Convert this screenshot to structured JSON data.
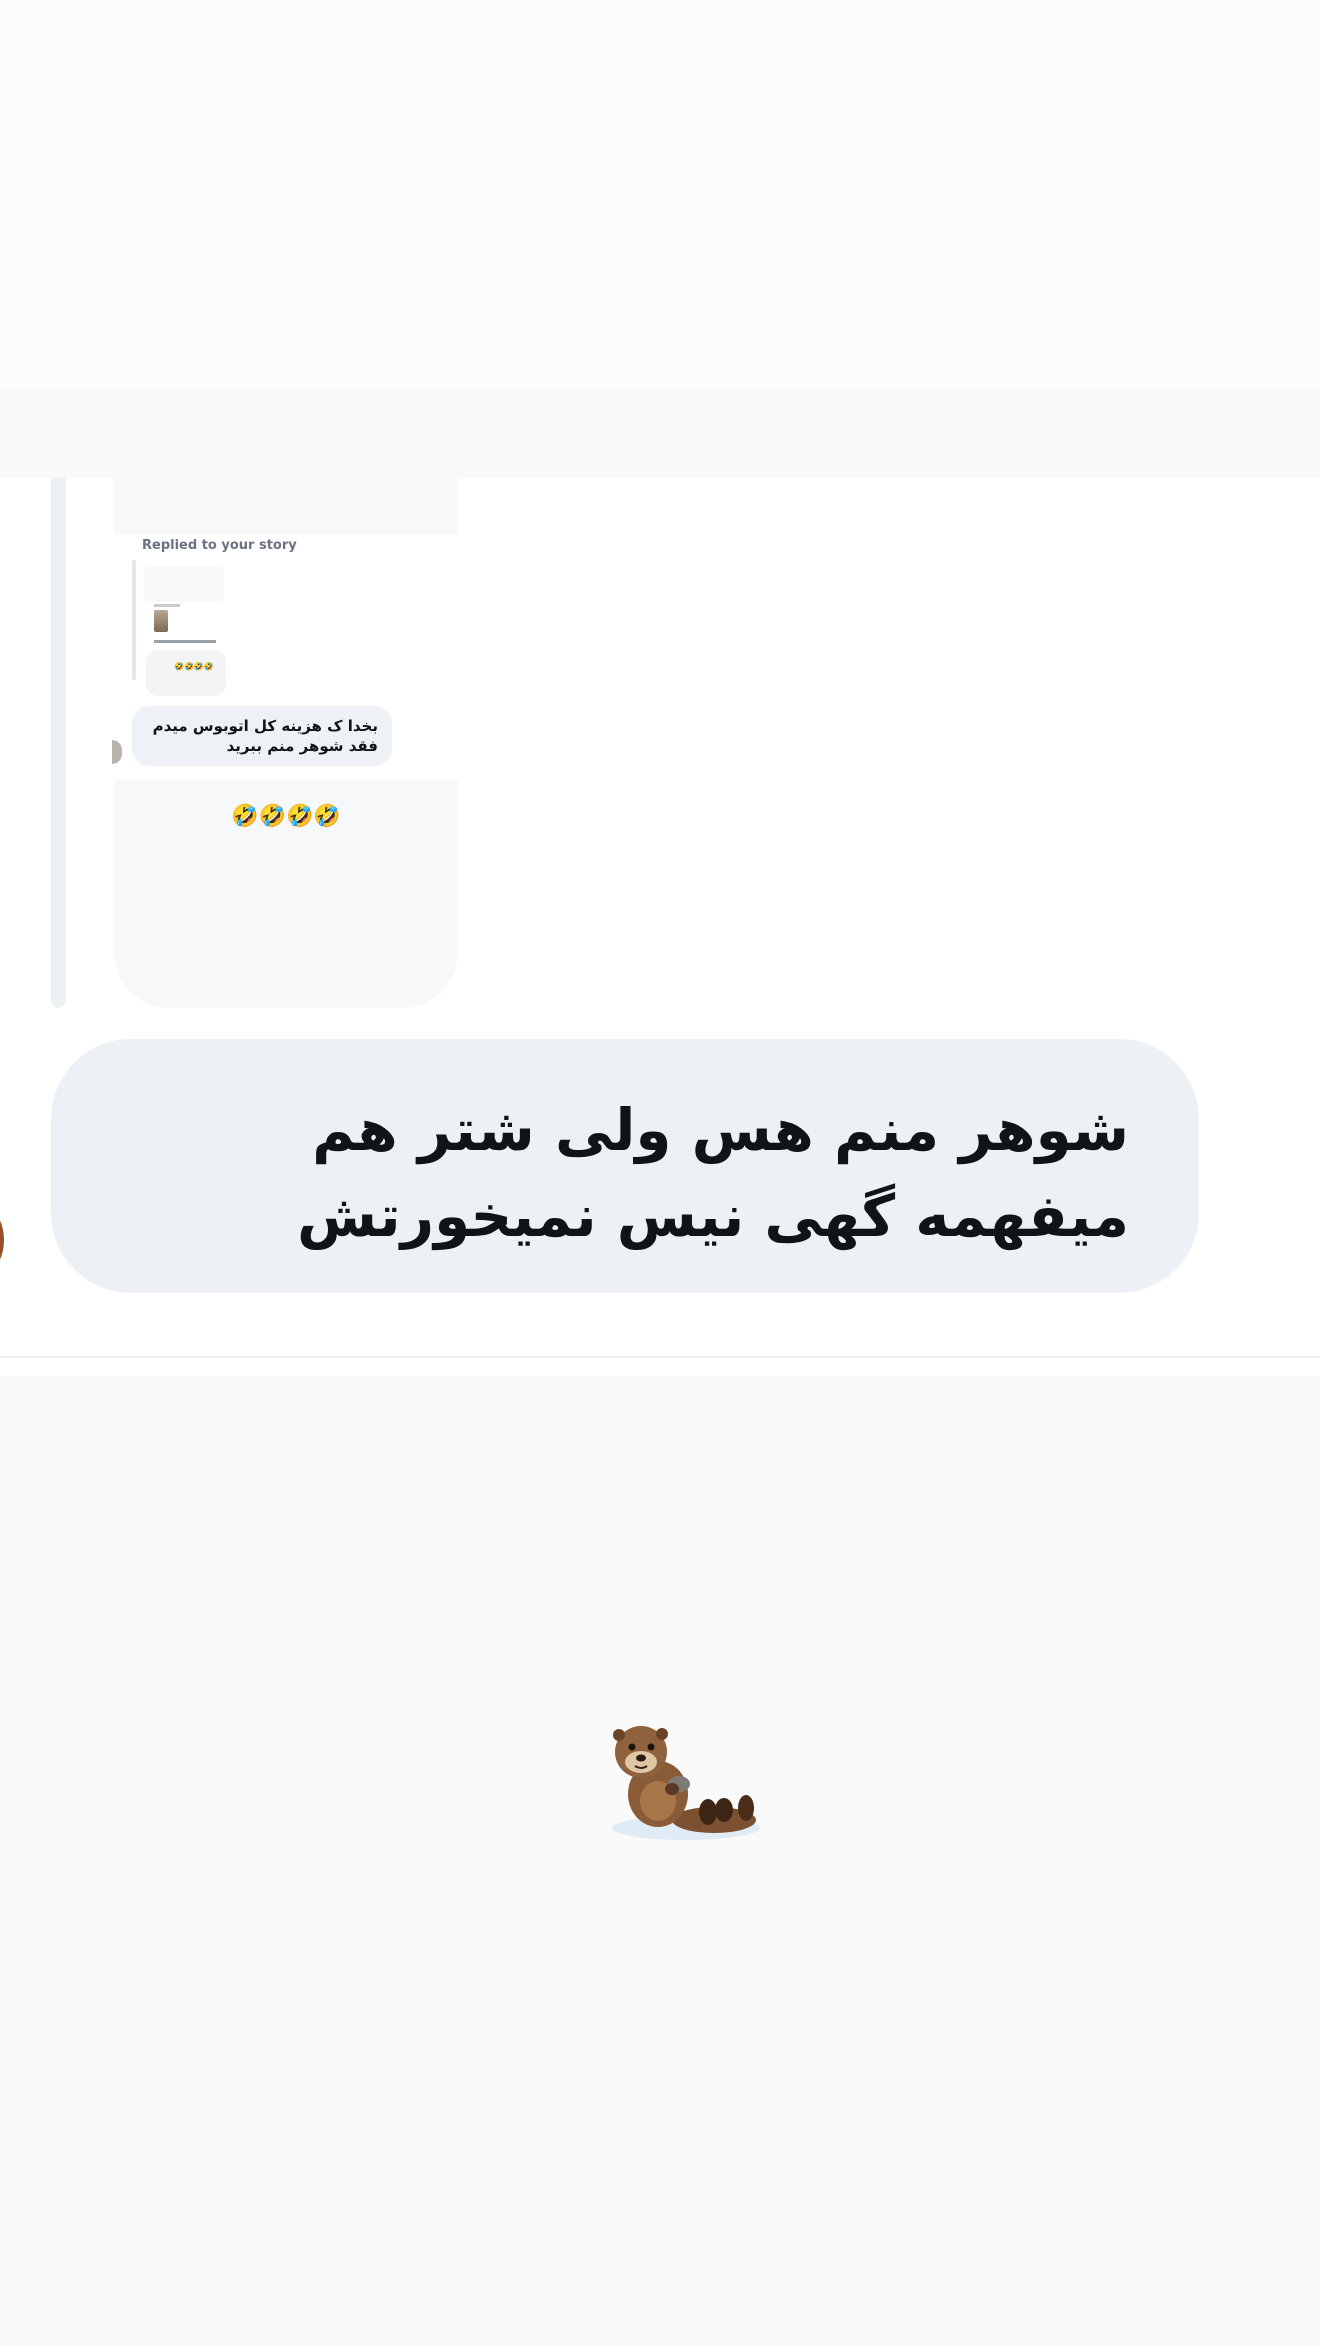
{
  "story_reply": {
    "replied_label": "Replied to your story",
    "mini_emojis": "🤣🤣🤣🤣"
  },
  "messages": {
    "small_text": "بخدا ک هزینه کل اتوبوس میدم فقد شوهر منم ببرید",
    "emoji_reaction": "🤣🤣🤣🤣",
    "main_text": "شوهر منم هس ولی شتر هم میفهمه گهی نیس نمیخورتش"
  },
  "sticker": {
    "name": "sea-otter-icon"
  }
}
